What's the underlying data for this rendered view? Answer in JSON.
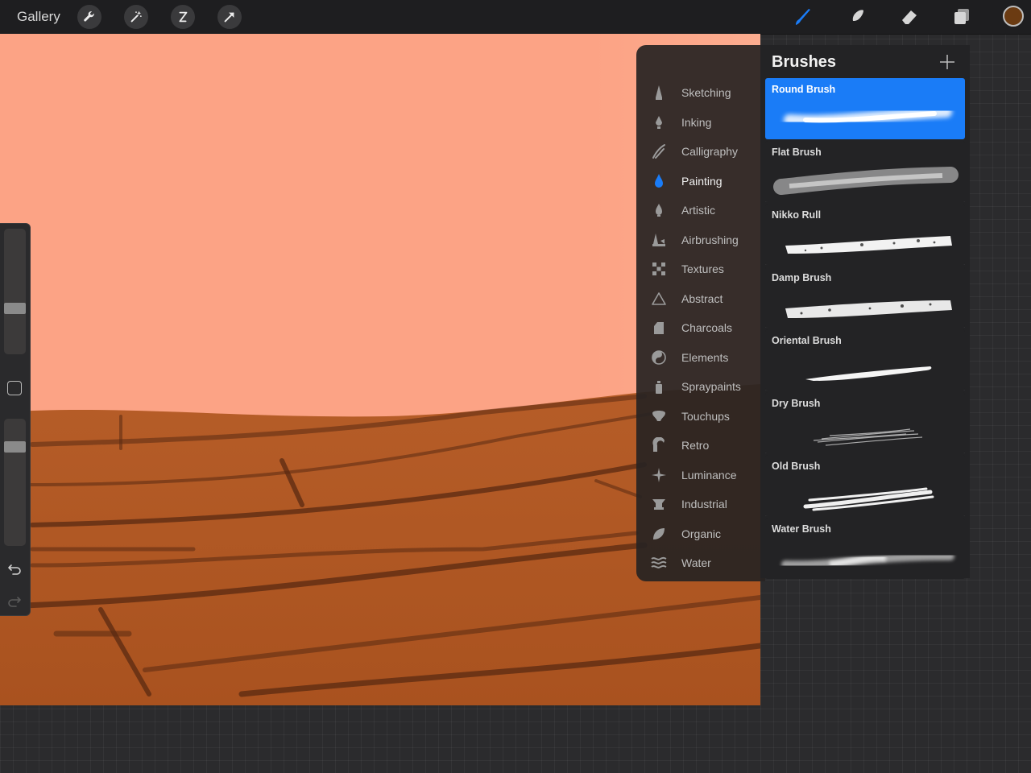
{
  "topbar": {
    "gallery_label": "Gallery",
    "left_tools": [
      "wrench-icon",
      "magic-wand-icon",
      "selection-icon",
      "transform-arrow-icon"
    ],
    "right_tools": [
      "brush-icon",
      "smudge-icon",
      "eraser-icon",
      "layers-icon"
    ],
    "active_tool": "brush-icon",
    "current_color": "#6b3b12"
  },
  "colors": {
    "accent": "#1a7cf7",
    "sky": "#fca385",
    "ground": "#b35a27"
  },
  "categories": {
    "active": "Painting",
    "items": [
      {
        "label": "Sketching",
        "icon": "pencil-tip-icon"
      },
      {
        "label": "Inking",
        "icon": "ink-drop-icon"
      },
      {
        "label": "Calligraphy",
        "icon": "calligraphy-stroke-icon"
      },
      {
        "label": "Painting",
        "icon": "paint-drop-icon"
      },
      {
        "label": "Artistic",
        "icon": "artistic-drop-icon"
      },
      {
        "label": "Airbrushing",
        "icon": "airbrush-icon"
      },
      {
        "label": "Textures",
        "icon": "checker-icon"
      },
      {
        "label": "Abstract",
        "icon": "triangle-icon"
      },
      {
        "label": "Charcoals",
        "icon": "charcoal-icon"
      },
      {
        "label": "Elements",
        "icon": "yin-yang-icon"
      },
      {
        "label": "Spraypaints",
        "icon": "spray-can-icon"
      },
      {
        "label": "Touchups",
        "icon": "touchup-icon"
      },
      {
        "label": "Retro",
        "icon": "retro-icon"
      },
      {
        "label": "Luminance",
        "icon": "sparkle-icon"
      },
      {
        "label": "Industrial",
        "icon": "anvil-icon"
      },
      {
        "label": "Organic",
        "icon": "leaf-icon"
      },
      {
        "label": "Water",
        "icon": "waves-icon"
      }
    ]
  },
  "brushes": {
    "title": "Brushes",
    "add_icon": "plus-icon",
    "selected": "Round Brush",
    "items": [
      {
        "name": "Round Brush"
      },
      {
        "name": "Flat Brush"
      },
      {
        "name": "Nikko Rull"
      },
      {
        "name": "Damp Brush"
      },
      {
        "name": "Oriental Brush"
      },
      {
        "name": "Dry Brush"
      },
      {
        "name": "Old Brush"
      },
      {
        "name": "Water Brush"
      }
    ]
  },
  "sidebar": {
    "size_slider_level": 0.38,
    "opacity_slider_level": 0.78,
    "modify_button_icon": "square-icon",
    "undo_icon": "undo-icon",
    "redo_icon": "redo-icon"
  }
}
